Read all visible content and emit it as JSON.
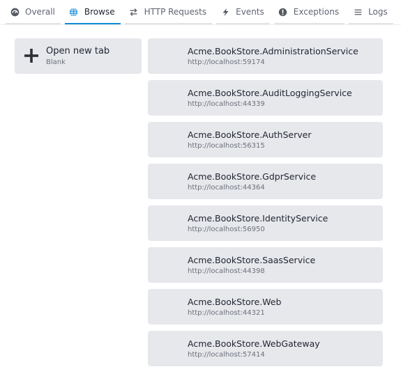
{
  "tabs": [
    {
      "label": "Overall",
      "icon": "dashboard-icon",
      "active": false
    },
    {
      "label": "Browse",
      "icon": "globe-icon",
      "active": true
    },
    {
      "label": "HTTP Requests",
      "icon": "arrows-exchange-icon",
      "active": false
    },
    {
      "label": "Events",
      "icon": "lightning-icon",
      "active": false
    },
    {
      "label": "Exceptions",
      "icon": "exclamation-circle-icon",
      "active": false
    },
    {
      "label": "Logs",
      "icon": "list-lines-icon",
      "active": false
    }
  ],
  "accent_color": "#0d8ad6",
  "new_tab": {
    "title": "Open new tab",
    "subtitle": "Blank"
  },
  "services": [
    {
      "name": "Acme.BookStore.AdministrationService",
      "url": "http://localhost:59174"
    },
    {
      "name": "Acme.BookStore.AuditLoggingService",
      "url": "http://localhost:44339"
    },
    {
      "name": "Acme.BookStore.AuthServer",
      "url": "http://localhost:56315"
    },
    {
      "name": "Acme.BookStore.GdprService",
      "url": "http://localhost:44364"
    },
    {
      "name": "Acme.BookStore.IdentityService",
      "url": "http://localhost:56950"
    },
    {
      "name": "Acme.BookStore.SaasService",
      "url": "http://localhost:44398"
    },
    {
      "name": "Acme.BookStore.Web",
      "url": "http://localhost:44321"
    },
    {
      "name": "Acme.BookStore.WebGateway",
      "url": "http://localhost:57414"
    }
  ]
}
